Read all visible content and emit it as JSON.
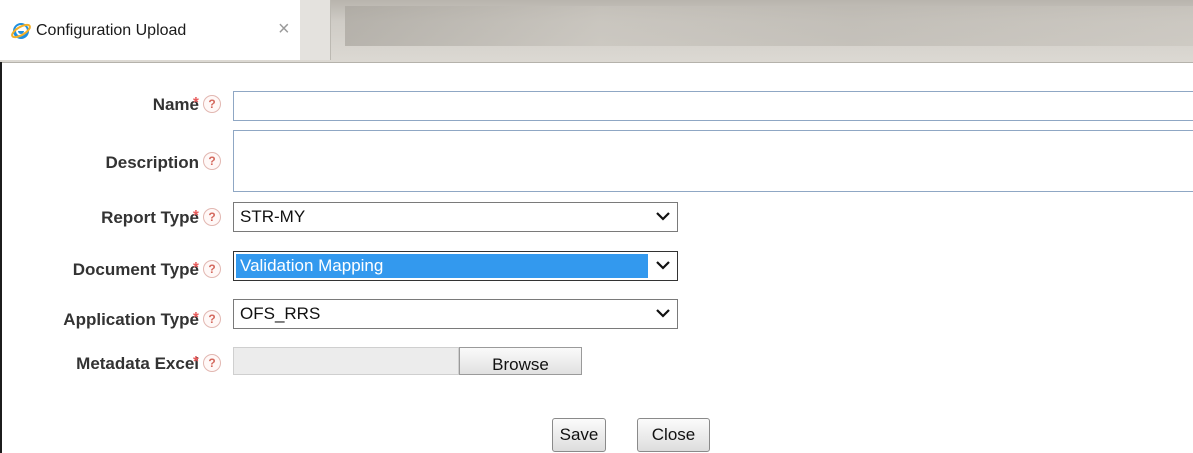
{
  "tab": {
    "title": "Configuration Upload",
    "close_glyph": "×",
    "icon": "ie-icon"
  },
  "form": {
    "name_label": "Name",
    "description_label": "Description",
    "report_type_label": "Report Type",
    "report_type_value": "STR-MY",
    "document_type_label": "Document Type",
    "document_type_value": "Validation Mapping",
    "application_type_label": "Application Type",
    "application_type_value": "OFS_RRS",
    "metadata_excel_label": "Metadata Excel",
    "required_mark": "*",
    "help_glyph": "?"
  },
  "buttons": {
    "browse": "Browse",
    "save": "Save",
    "close": "Close"
  },
  "colors": {
    "required": "#e85a5a",
    "selection": "#3399ee",
    "input_border": "#8fa7c4"
  }
}
